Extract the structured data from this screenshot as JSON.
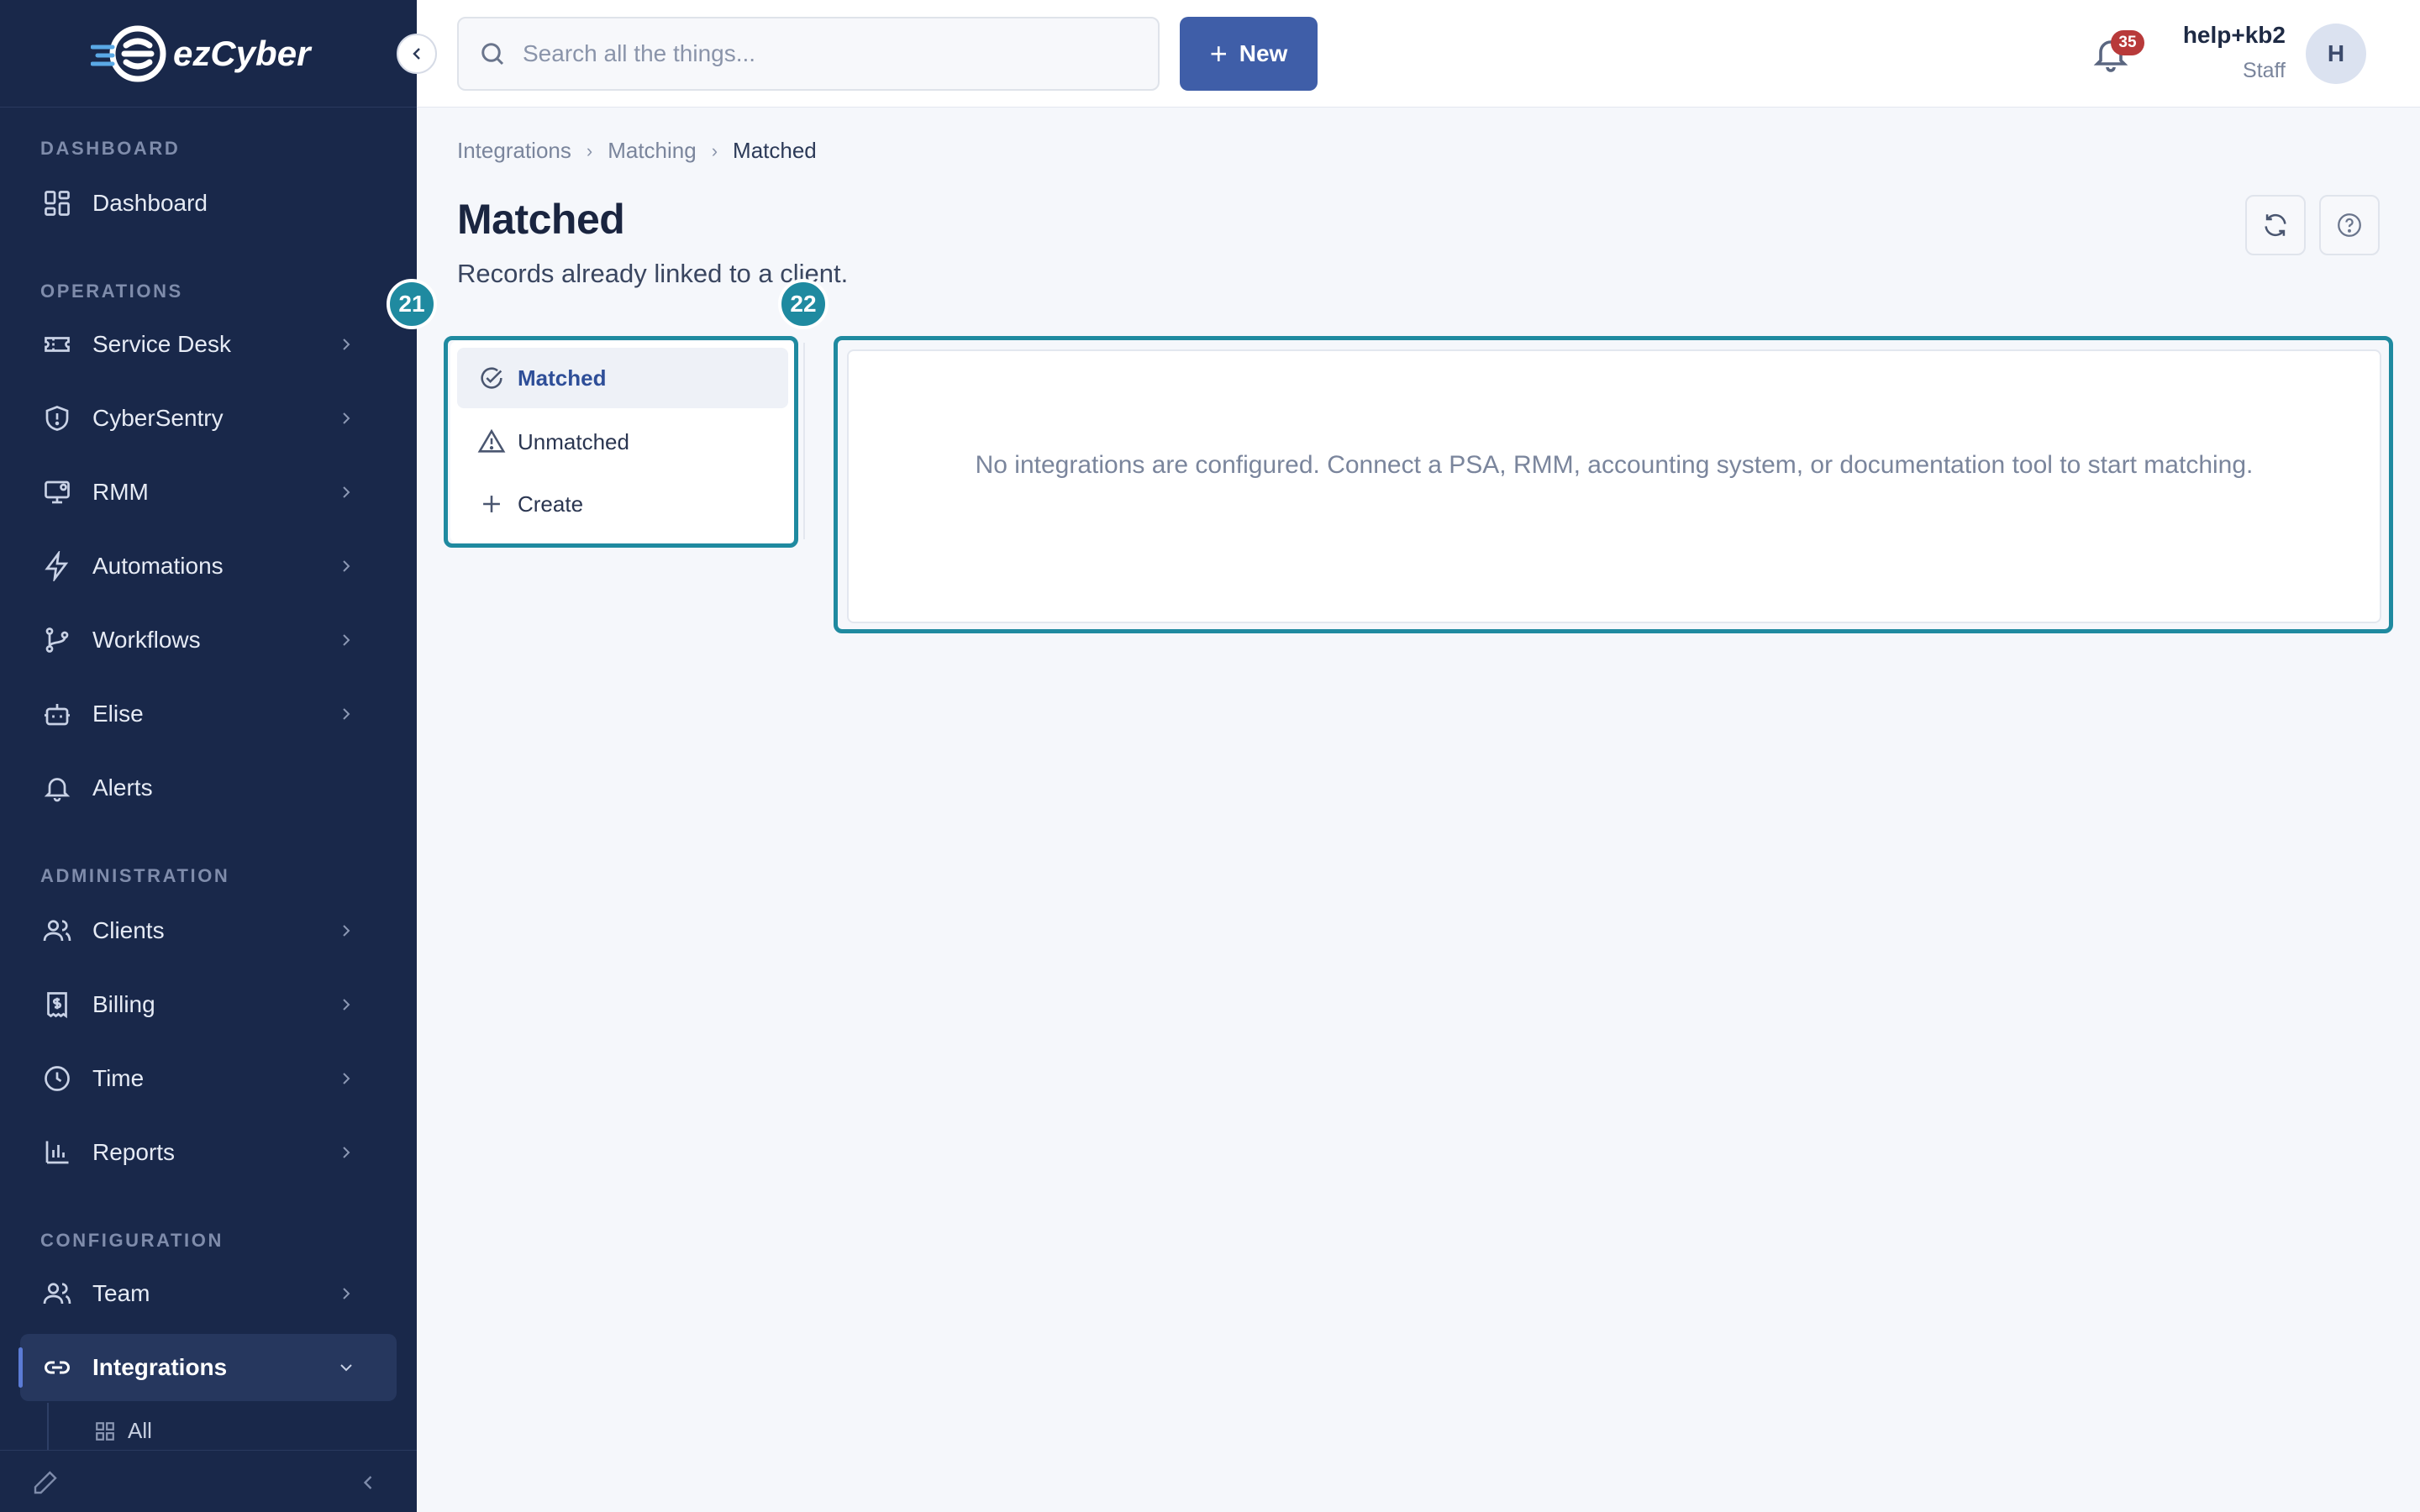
{
  "app": {
    "logo_text": "ezCyber"
  },
  "sidebar": {
    "sections": {
      "dashboard": "DASHBOARD",
      "operations": "OPERATIONS",
      "administration": "ADMINISTRATION",
      "configuration": "CONFIGURATION"
    },
    "items": [
      {
        "label": "Dashboard",
        "icon": "dashboard-icon"
      },
      {
        "label": "Service Desk",
        "icon": "ticket-icon"
      },
      {
        "label": "CyberSentry",
        "icon": "shield-icon"
      },
      {
        "label": "RMM",
        "icon": "monitor-icon"
      },
      {
        "label": "Automations",
        "icon": "lightning-icon"
      },
      {
        "label": "Workflows",
        "icon": "workflow-icon"
      },
      {
        "label": "Elise",
        "icon": "robot-icon"
      },
      {
        "label": "Alerts",
        "icon": "bell-icon"
      },
      {
        "label": "Clients",
        "icon": "users-icon"
      },
      {
        "label": "Billing",
        "icon": "receipt-icon"
      },
      {
        "label": "Time",
        "icon": "clock-icon"
      },
      {
        "label": "Reports",
        "icon": "bar-chart-icon"
      },
      {
        "label": "Team",
        "icon": "team-icon"
      },
      {
        "label": "Integrations",
        "icon": "link-icon",
        "active": true
      }
    ],
    "sub_items": [
      {
        "label": "All",
        "icon": "grid-icon"
      }
    ]
  },
  "topbar": {
    "search_placeholder": "Search all the things...",
    "new_button": "New",
    "notification_count": "35",
    "user_name": "help+kb2",
    "user_role": "Staff",
    "avatar_initial": "H"
  },
  "breadcrumb": [
    "Integrations",
    "Matching",
    "Matched"
  ],
  "page": {
    "title": "Matched",
    "subtitle": "Records already linked to a client."
  },
  "tabs": [
    {
      "label": "Matched",
      "icon": "check-circle-icon",
      "active": true
    },
    {
      "label": "Unmatched",
      "icon": "warning-icon"
    },
    {
      "label": "Create",
      "icon": "plus-icon"
    }
  ],
  "empty_state": "No integrations are configured. Connect a PSA, RMM, accounting system, or documentation tool to start matching.",
  "markers": [
    "21",
    "22"
  ],
  "colors": {
    "sidebar_bg": "#19284a",
    "primary": "#3f5ea8",
    "highlight": "#1f8aa0",
    "badge": "#b83a3a"
  }
}
